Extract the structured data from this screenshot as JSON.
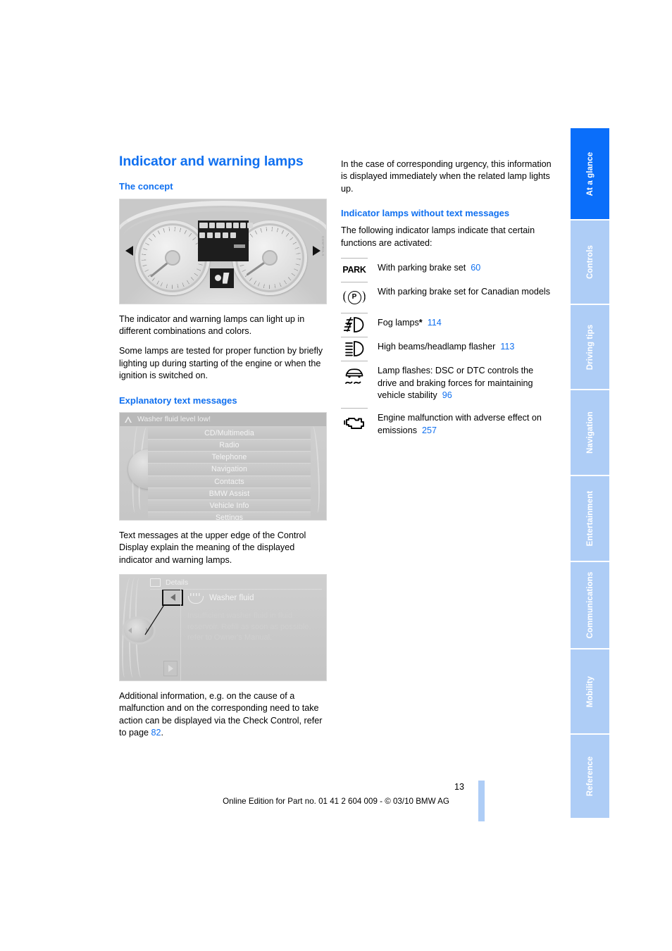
{
  "document": {
    "page_number": "13",
    "footer_text": "Online Edition for Part no. 01 41 2 604 009 - © 03/10 BMW AG"
  },
  "colors": {
    "heading_blue": "#1070f0",
    "tab_active": "#0a6efa",
    "tab_inactive": "#aecdf6",
    "page_ref_blue": "#1070f0"
  },
  "left_column": {
    "title": "Indicator and warning lamps",
    "section_concept": {
      "heading": "The concept",
      "figure": {
        "name": "instrument-cluster-photo",
        "credit": "CONTROLS"
      },
      "paragraphs": [
        "The indicator and warning lamps can light up in different combinations and colors.",
        "Some lamps are tested for proper function by briefly lighting up during starting of the engine or when the ignition is switched on."
      ]
    },
    "section_text_messages": {
      "heading": "Explanatory text messages",
      "menu_screenshot": {
        "warning_text": "Washer fluid level low!",
        "items": [
          "CD/Multimedia",
          "Radio",
          "Telephone",
          "Navigation",
          "Contacts",
          "BMW Assist",
          "Vehicle Info",
          "Settings"
        ]
      },
      "paragraph_after_menu": "Text messages at the upper edge of the Control Display explain the meaning of the displayed indicator and warning lamps.",
      "details_screenshot": {
        "title": "Details",
        "item_label": "Washer fluid",
        "body_text": "Insufficient washer fluid in fluid reservoir. Refill as soon as possible, refer to Owner's Manual."
      },
      "final_paragraph": {
        "text_before": "Additional information, e.g. on the cause of a malfunction and on the corresponding need to take action can be displayed via the Check Control, refer to page ",
        "page_ref": "82",
        "text_after": "."
      }
    }
  },
  "right_column": {
    "intro_paragraph": "In the case of corresponding urgency, this information is displayed immediately when the related lamp lights up.",
    "section_heading": "Indicator lamps without text messages",
    "section_intro": "The following indicator lamps indicate that certain functions are activated:",
    "lamps": [
      {
        "icon": "park-brake-text-icon",
        "text": "With parking brake set",
        "page_ref": "60",
        "suffix": ""
      },
      {
        "icon": "park-brake-canadian-icon",
        "text": "With parking brake set for Canadian models",
        "page_ref": "",
        "suffix": ""
      },
      {
        "icon": "fog-lamp-icon",
        "text": "Fog lamps",
        "page_ref": "114",
        "suffix": "*"
      },
      {
        "icon": "high-beam-icon",
        "text": "High beams/headlamp flasher",
        "page_ref": "113",
        "suffix": ""
      },
      {
        "icon": "dsc-dtc-icon",
        "text": "Lamp flashes: DSC or DTC controls the drive and braking forces for maintaining vehicle stability",
        "page_ref": "96",
        "suffix": ""
      },
      {
        "icon": "engine-malfunction-icon",
        "text": "Engine malfunction with adverse effect on emissions",
        "page_ref": "257",
        "suffix": ""
      }
    ]
  },
  "sidebar": {
    "tabs": [
      {
        "label": "At a glance",
        "active": true
      },
      {
        "label": "Controls",
        "active": false
      },
      {
        "label": "Driving tips",
        "active": false
      },
      {
        "label": "Navigation",
        "active": false
      },
      {
        "label": "Entertainment",
        "active": false
      },
      {
        "label": "Communications",
        "active": false
      },
      {
        "label": "Mobility",
        "active": false
      },
      {
        "label": "Reference",
        "active": false
      }
    ]
  }
}
